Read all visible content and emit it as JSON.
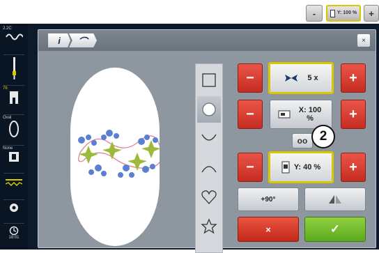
{
  "top_controls": {
    "minus_label": "-",
    "value_label": "Y: 100 %",
    "plus_label": "+"
  },
  "sidebar": {
    "items": [
      {
        "caption": "2.2C",
        "icon": "stitch-pattern-icon"
      },
      {
        "caption": "",
        "icon": "needle-icon"
      },
      {
        "caption": "76",
        "icon": "presser-foot-icon"
      },
      {
        "caption": "Oval",
        "icon": "hoop-icon"
      },
      {
        "caption": "None",
        "icon": "stitch-plate-icon"
      },
      {
        "caption": "",
        "icon": "thread-tension-icon"
      },
      {
        "caption": "",
        "icon": "settings-icon"
      },
      {
        "caption": "18:01",
        "icon": "clock-icon"
      }
    ]
  },
  "dialog": {
    "breadcrumb": [
      "i",
      "⌒"
    ],
    "close_label": "×",
    "shapes": [
      "square",
      "circle",
      "arc-down",
      "arc-up",
      "heart",
      "star"
    ],
    "selected_shape": "circle",
    "repeat": {
      "minus": "−",
      "value": "5 x",
      "plus": "+"
    },
    "scale_x": {
      "minus": "−",
      "value": "X: 100 %",
      "plus": "+"
    },
    "link_label": "oo",
    "scale_y": {
      "minus": "−",
      "value": "Y: 40 %",
      "plus": "+"
    },
    "rotate_label": "+90°",
    "cancel_label": "×",
    "ok_label": "✓"
  },
  "callout": "2",
  "colors": {
    "accent": "#d9c800",
    "cancel": "#d23a2c",
    "ok": "#6fbe2b",
    "screen": "#0c1a2c"
  }
}
